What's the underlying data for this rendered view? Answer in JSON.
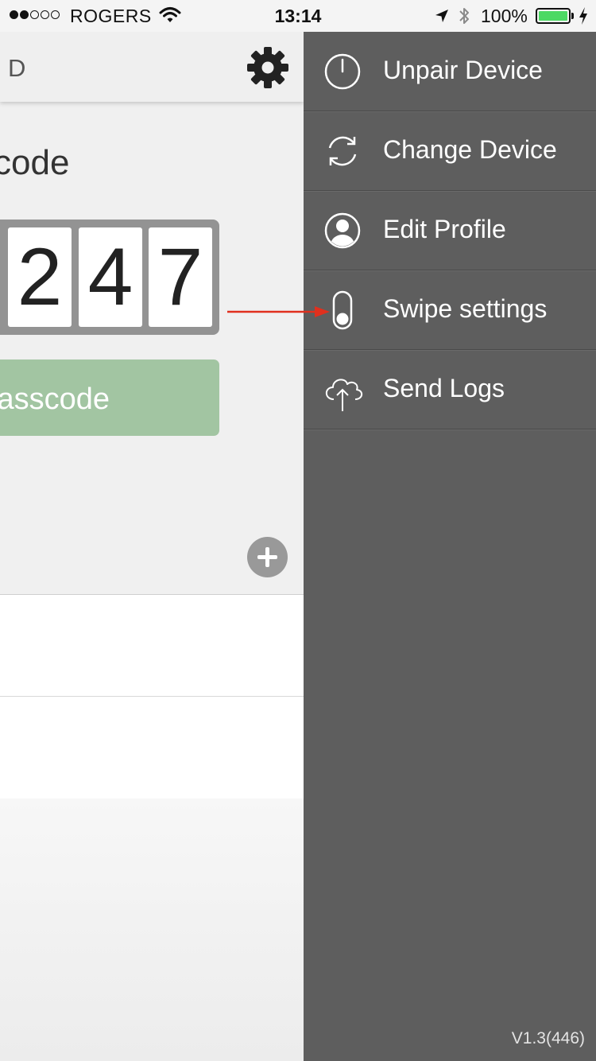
{
  "status_bar": {
    "carrier": "ROGERS",
    "time": "13:14",
    "battery_percent": "100%",
    "battery_level": 1.0,
    "signal_bars_filled": 2,
    "signal_bars_total": 5
  },
  "nav": {
    "title_partial": "D",
    "settings_icon": "gear-icon"
  },
  "main": {
    "heading_partial": "code",
    "digits": [
      "2",
      "4",
      "7"
    ],
    "button_label_partial": "asscode",
    "add_icon": "plus-icon"
  },
  "drawer": {
    "items": [
      {
        "label": "Unpair Device",
        "icon": "power-icon"
      },
      {
        "label": "Change Device",
        "icon": "refresh-icon"
      },
      {
        "label": "Edit Profile",
        "icon": "profile-icon"
      },
      {
        "label": "Swipe settings",
        "icon": "toggle-icon"
      },
      {
        "label": "Send Logs",
        "icon": "cloud-upload-icon"
      }
    ],
    "version": "V1.3(446)"
  },
  "colors": {
    "drawer_bg": "#5e5e5e",
    "accent_green": "#a2c5a2",
    "battery_green": "#4cd964",
    "annotation_red": "#e0301e",
    "add_button": "#999999"
  }
}
